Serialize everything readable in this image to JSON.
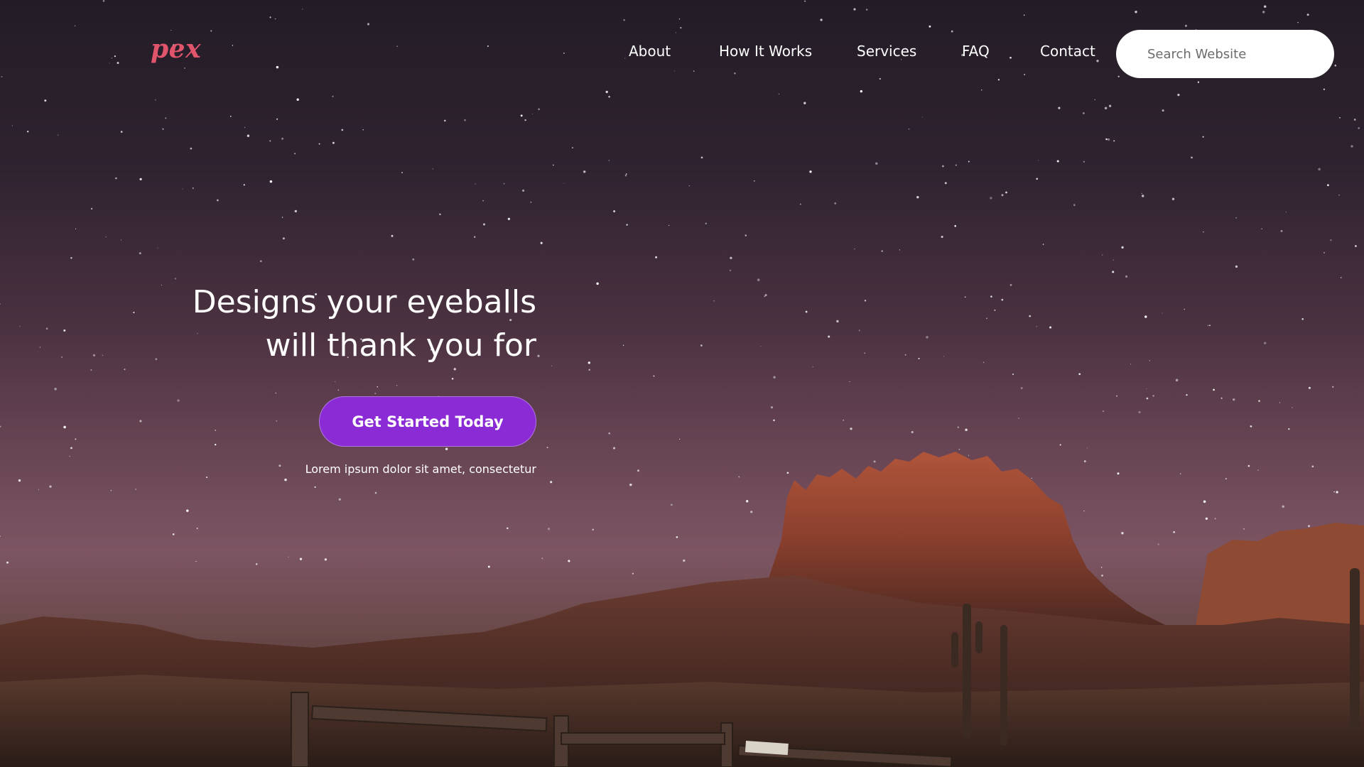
{
  "brand": {
    "logo_text": "pex",
    "logo_color": "#e0556c"
  },
  "nav": {
    "items": [
      {
        "label": "About"
      },
      {
        "label": "How It Works"
      },
      {
        "label": "Services"
      },
      {
        "label": "FAQ"
      },
      {
        "label": "Contact"
      }
    ]
  },
  "search": {
    "placeholder": "Search Website",
    "value": ""
  },
  "hero": {
    "title_line1": "Designs your eyeballs",
    "title_line2": "will thank you for",
    "cta_label": "Get Started Today",
    "cta_color": "#8a2bd6",
    "subtext": "Lorem ipsum dolor sit amet, consectetur"
  }
}
